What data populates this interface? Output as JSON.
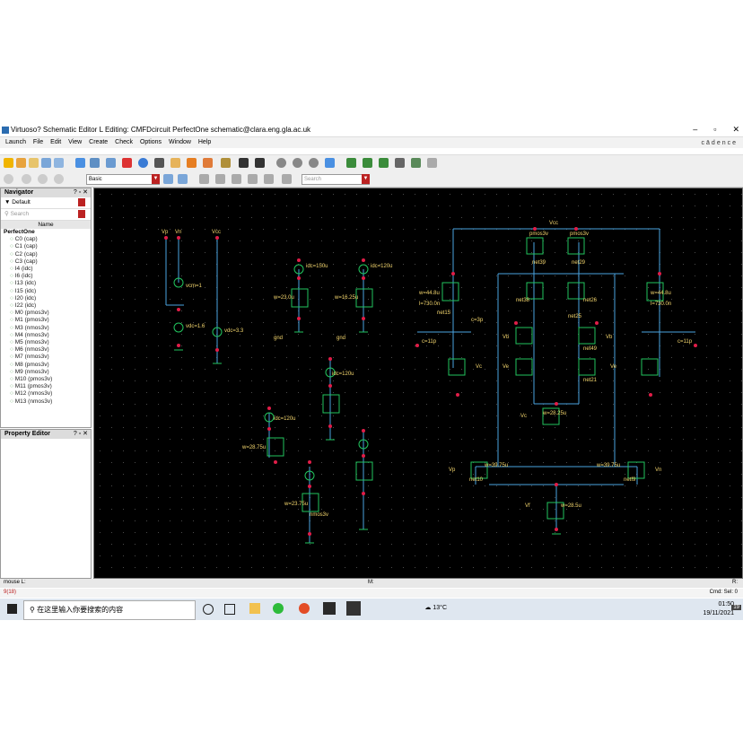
{
  "window": {
    "title": "Virtuoso? Schematic Editor L Editing: CMFDcircuit PerfectOne schematic@clara.eng.gla.ac.uk",
    "minimize": "–",
    "maximize": "▫",
    "close": "✕",
    "brand": "cādence"
  },
  "menu": [
    "Launch",
    "File",
    "Edit",
    "View",
    "Create",
    "Check",
    "Options",
    "Window",
    "Help"
  ],
  "toolbar": {
    "view_combo": "Basic",
    "search_placeholder": "Search"
  },
  "navigator": {
    "title": "Navigator",
    "filter": "Default",
    "search_placeholder": "Search",
    "column_header": "Name",
    "root": "PerfectOne",
    "items": [
      "C0 (cap)",
      "C1 (cap)",
      "C2 (cap)",
      "C3 (cap)",
      "I4 (idc)",
      "I6 (idc)",
      "I13 (idc)",
      "I15 (idc)",
      "I20 (idc)",
      "I22 (idc)",
      "M0 (pmos3v)",
      "M1 (pmos3v)",
      "M3 (nmos3v)",
      "M4 (nmos3v)",
      "M5 (nmos3v)",
      "M6 (nmos3v)",
      "M7 (nmos3v)",
      "M8 (pmos3v)",
      "M9 (nmos3v)",
      "M10 (pmos3v)",
      "M11 (pmos3v)",
      "M12 (nmos3v)",
      "M13 (nmos3v)"
    ]
  },
  "property_editor": {
    "title": "Property Editor"
  },
  "schematic": {
    "labels": {
      "vp": "Vp",
      "vn": "Vn",
      "vcc": "Vcc",
      "vcm": "vcm=1",
      "vdc16": "vdc=1.6",
      "vdc33": "vdc=3.3",
      "gnd": "gnd",
      "idc150": "idc=150u",
      "idc120": "idc=120u",
      "idc120b": "idc=120u",
      "idc120c": "idc=120u",
      "w23": "w=23.0u",
      "w16": "w=16.25u",
      "w28": "w=28.75u",
      "w2375": "w=23.75u",
      "pmos": "pmos3v",
      "nmos": "nmos3v",
      "net39": "net39",
      "net29": "net29",
      "net38": "net38",
      "net26": "net26",
      "net25": "net25",
      "net15": "net15",
      "net21": "net21",
      "net49": "net49",
      "net10": "net10",
      "netf9": "netf9",
      "vb": "Vb",
      "vc": "Vc",
      "ve": "Ve",
      "vf": "Vf",
      "cap3p": "c=3p",
      "cap11p": "c=11p",
      "w4475": "w=44.8u",
      "w3975": "w=39.75u",
      "w285": "w=28.5u",
      "w2825": "w=28.25u",
      "l730": "l=730.0n",
      "vin": "Vn",
      "vip": "Vp"
    }
  },
  "status": {
    "left": "mouse L:",
    "middle": "M:",
    "right": "R:",
    "line2_left": "9(18)",
    "line2_right": "Cmd: Sel: 0"
  },
  "taskbar": {
    "search_text": "在这里输入你要搜索的内容",
    "weather": "13°C",
    "time": "01:50",
    "date": "19/11/2021",
    "notification": "19"
  },
  "colors": {
    "canvas_bg": "#000000",
    "wire": "#4aa3e0",
    "device": "#22c55e",
    "pin": "#e11d48",
    "label": "#f5d76e"
  }
}
